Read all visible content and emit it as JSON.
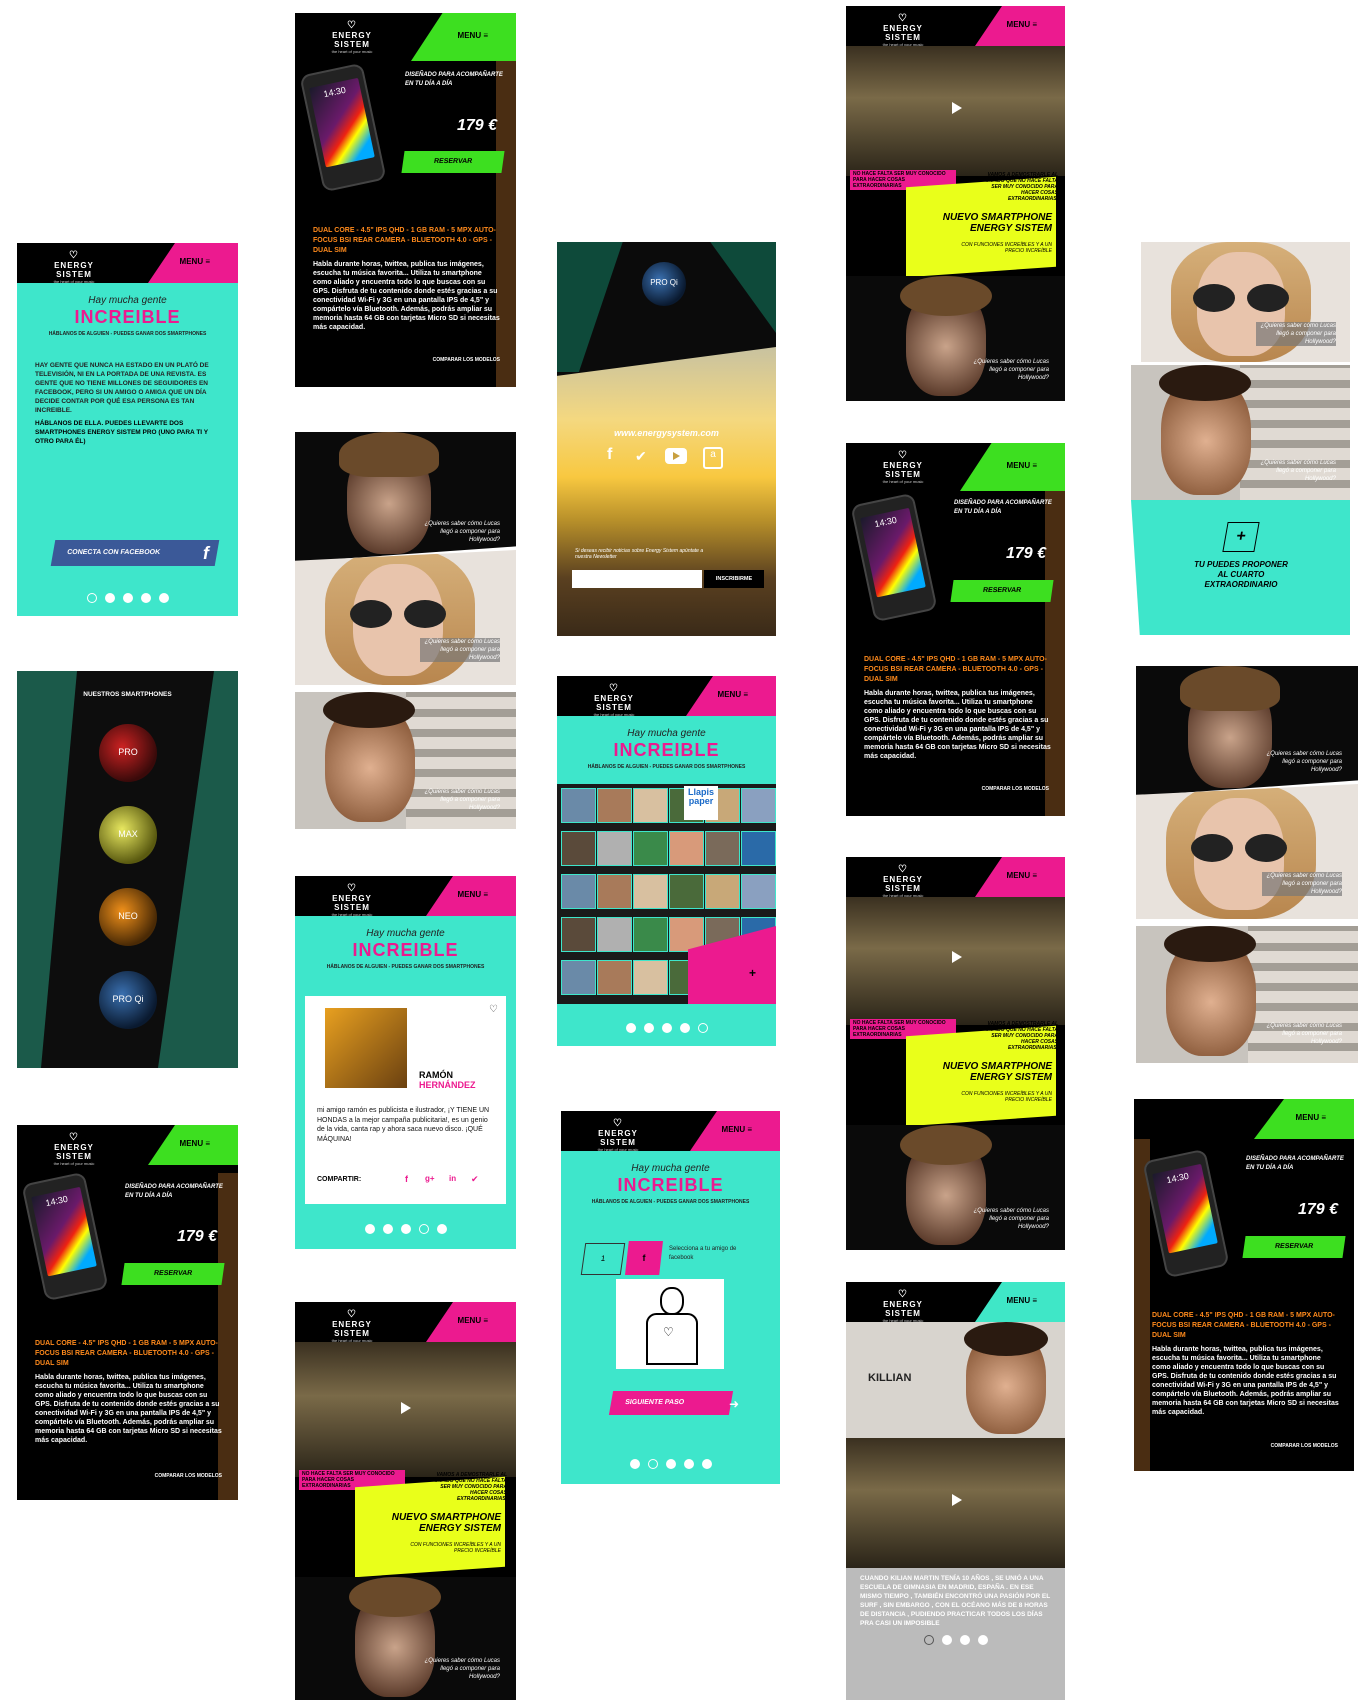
{
  "brand": {
    "logo": "ENERGY SISTEM",
    "tagline": "the heart of your music"
  },
  "menu_label": "MENU ≡",
  "screen1": {
    "script": "Hay mucha gente",
    "title": "INCREIBLE",
    "subtitle": "HÁBLANOS DE ALGUIEN - PUEDES GANAR DOS SMARTPHONES",
    "body": "HAY GENTE QUE NUNCA HA ESTADO EN UN PLATÓ DE TELEVISIÓN, NI EN LA PORTADA DE UNA REVISTA. ES GENTE QUE NO TIENE MILLONES DE SEGUIDORES EN FACEBOOK, PERO SI UN AMIGO O AMIGA QUE UN DÍA DECIDE CONTAR POR QUÉ ESA PERSONA ES TAN INCREIBLE.",
    "body_bold": "HÁBLANOS DE ELLA. PUEDES LLEVARTE DOS SMARTPHONES ENERGY SISTEM PRO (UNO PARA TI Y OTRO PARA ÉL)",
    "fb_button": "CONECTA CON FACEBOOK"
  },
  "smartphones": {
    "title": "NUESTROS SMARTPHONES",
    "models": [
      "PRO",
      "MAX",
      "NEO",
      "PRO Qi"
    ]
  },
  "product": {
    "tagline": "DISEÑADO PARA ACOMPAÑARTE EN TU DÍA A DÍA",
    "price": "179 €",
    "reserve": "RESERVAR",
    "time": "14:30",
    "specs": "DUAL CORE - 4.5\" IPS QHD - 1 GB RAM - 5 MPX AUTO-FOCUS BSI REAR CAMERA - BLUETOOTH 4.0 - GPS - DUAL SIM",
    "description": "Habla durante horas, twittea, publica tus imágenes, escucha tu música favorita... Utiliza tu smartphone como aliado y encuentra todo lo que buscas con su GPS. Disfruta de tu contenido donde estés gracias a su conectividad Wi-Fi y 3G en una pantalla IPS de 4,5\" y compártelo vía Bluetooth. Además, podrás ampliar su memoria hasta 64 GB con tarjetas Micro SD si necesitas más capacidad.",
    "compare": "COMPARAR LOS MODELOS"
  },
  "faces": {
    "caption": "¿Quieres saber cómo Lucas llegó a componer para Hollywood?"
  },
  "social": {
    "proqi": "PRO Qi",
    "url": "www.energysystem.com",
    "newsletter": "Si deseas recibir noticias sobre Energy Sistem apúntate a nuestra Newsletter",
    "subscribe": "INSCRIBIRME"
  },
  "ramon": {
    "first": "RAMÓN",
    "last": "HERNÁNDEZ",
    "text": "mi amigo ramón es publicista e ilustrador, ¡Y TIENE UN HONDAS a la mejor campaña publicitaria!, es un genio de la vida, canta rap y ahora saca nuevo disco. ¡QUÉ MÁQUINA!",
    "share": "COMPARTIR:"
  },
  "video": {
    "badge": "NO HACE FALTA SER MUY CONOCIDO PARA HACER COSAS EXTRAORDINARIAS",
    "right": "VAMOS A DEMOSTRARLE AL MUNDO QUE NO HACE FALTA SER MUY CONOCIDO PARA HACER COSAS EXTRAORDINARIAS.",
    "headline": "NUEVO SMARTPHONE ENERGY SISTEM",
    "small": "CON FUNCIONES INCREÍBLES Y A UN PRECIO INCREÍBLE"
  },
  "wizard": {
    "step": "1",
    "fb_letter": "f",
    "instruction": "Selecciona a tu amigo de facebook",
    "next": "SIGUIENTE PASO"
  },
  "killian": {
    "name": "KILLIAN",
    "text": "CUANDO KILIAN MARTIN TENÍA 10 AÑOS , SE UNIÓ A UNA ESCUELA DE GIMNASIA EN MADRID, ESPAÑA . EN ESE MISMO TIEMPO , TAMBIÉN ENCONTRÓ UNA PASIÓN POR EL SURF , SIN EMBARGO , CON EL OCÉANO MÁS DE 8 HORAS DE DISTANCIA , PUDIENDO PRACTICAR TODOS LOS DÍAS PRA CASI UN IMPOSIBLE"
  },
  "propose": {
    "plus": "+",
    "text": "TU PUEDES PROPONER AL CUARTO EXTRAORDINARIO"
  },
  "grid_tiles": [
    "Llapis paper"
  ],
  "colors": {
    "magenta": "#ec1a8f",
    "green": "#3ddf20",
    "cyan": "#3ee6cb",
    "yellow": "#e9ff1a",
    "orange": "#ff8a1c"
  }
}
